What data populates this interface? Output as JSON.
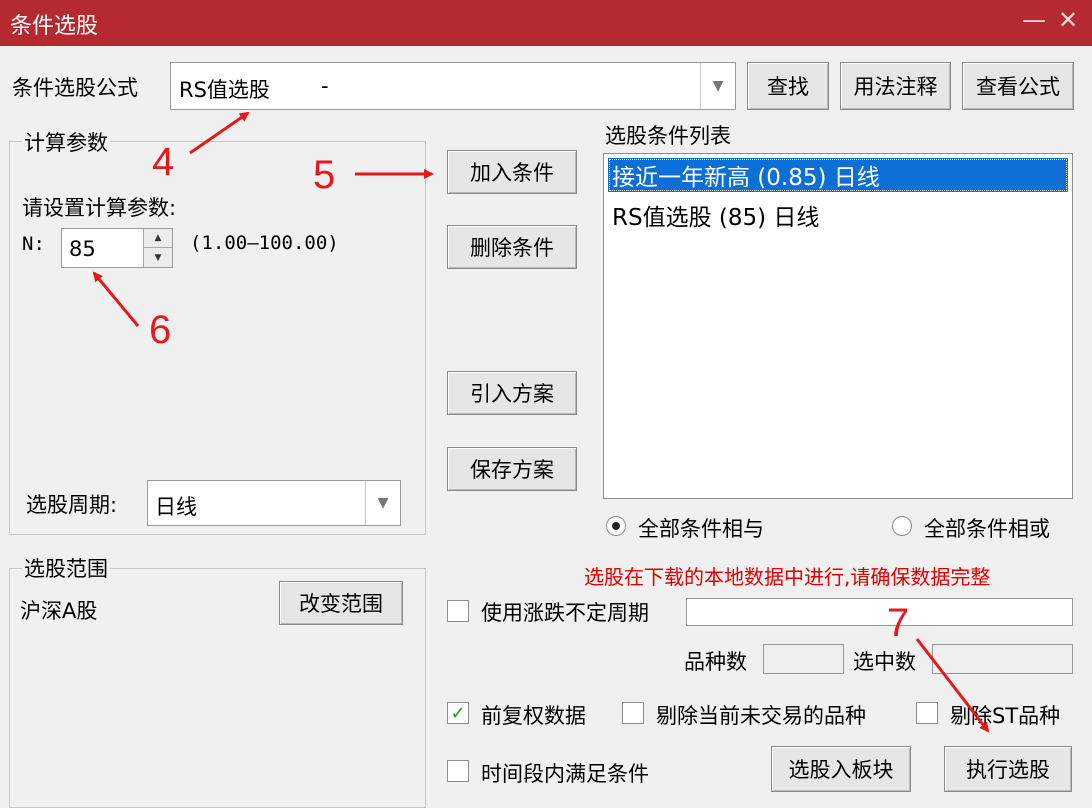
{
  "window": {
    "title": "条件选股",
    "minimize_glyph": "—",
    "close_glyph": "✕"
  },
  "formula": {
    "label": "条件选股公式",
    "value": "RS值选股",
    "suffix": "-",
    "find_button": "查找",
    "usage_button": "用法注释",
    "view_button": "查看公式"
  },
  "params": {
    "group_title": "计算参数",
    "prompt": "请设置计算参数:",
    "n_label": "N:",
    "n_value": "85",
    "n_range": "(1.00—100.00)",
    "period_label": "选股周期:",
    "period_value": "日线"
  },
  "actions": {
    "add": "加入条件",
    "delete": "删除条件",
    "import": "引入方案",
    "save": "保存方案"
  },
  "condition_list": {
    "title": "选股条件列表",
    "items": [
      "接近一年新高 (0.85) 日线",
      "RS值选股 (85) 日线"
    ],
    "selected_index": 0
  },
  "logic": {
    "and_label": "全部条件相与",
    "or_label": "全部条件相或",
    "selected": "and"
  },
  "scope": {
    "group_title": "选股范围",
    "value": "沪深A股",
    "change_button": "改变范围"
  },
  "notice": "选股在下载的本地数据中进行,请确保数据完整",
  "options": {
    "variable_period": {
      "label": "使用涨跌不定周期",
      "checked": false
    },
    "variety_count_label": "品种数",
    "selected_count_label": "选中数",
    "forward_adjust": {
      "label": "前复权数据",
      "checked": true
    },
    "exclude_untraded": {
      "label": "剔除当前未交易的品种",
      "checked": false
    },
    "exclude_st": {
      "label": "剔除ST品种",
      "checked": false
    },
    "period_satisfy": {
      "label": "时间段内满足条件",
      "checked": false
    }
  },
  "bottom_buttons": {
    "to_block": "选股入板块",
    "execute": "执行选股"
  },
  "annotations": {
    "a4": "4",
    "a5": "5",
    "a6": "6",
    "a7": "7"
  },
  "colors": {
    "titlebar": "#b52a31",
    "selection": "#0b6fd6",
    "annotation": "#e4191c",
    "notice": "#e00000"
  }
}
